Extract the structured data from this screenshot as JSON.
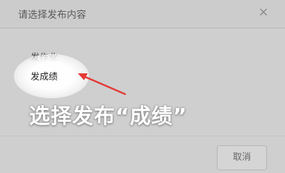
{
  "dialog": {
    "title": "请选择发布内容",
    "close_icon": "close-icon",
    "close_glyph": "×"
  },
  "options": [
    {
      "label": "发作业"
    },
    {
      "label": "发成绩"
    }
  ],
  "annotation": {
    "text": "选择发布“成绩”",
    "arrow_color": "#e53935"
  },
  "footer": {
    "cancel_label": "取消"
  }
}
